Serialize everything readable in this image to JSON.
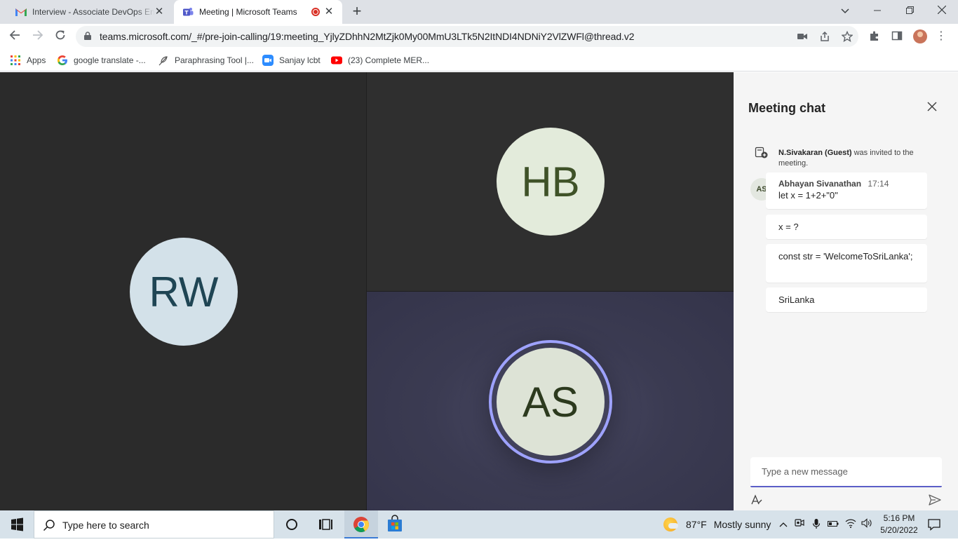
{
  "browser": {
    "tabs": [
      {
        "title": "Interview - Associate DevOps Eng",
        "icon": "gmail-icon"
      },
      {
        "title": "Meeting | Microsoft Teams",
        "icon": "teams-icon",
        "recording": true
      }
    ],
    "url": "teams.microsoft.com/_#/pre-join-calling/19:meeting_YjlyZDhhN2MtZjk0My00MmU3LTk5N2ItNDI4NDNiY2VlZWFl@thread.v2",
    "bookmarks": [
      {
        "label": "Apps",
        "icon": "apps-grid-icon"
      },
      {
        "label": "google translate -...",
        "icon": "google-icon"
      },
      {
        "label": "Paraphrasing Tool |...",
        "icon": "feather-icon"
      },
      {
        "label": "Sanjay lcbt",
        "icon": "zoom-icon"
      },
      {
        "label": "(23) Complete MER...",
        "icon": "youtube-icon"
      }
    ]
  },
  "meeting": {
    "participants": [
      {
        "initials": "RW"
      },
      {
        "initials": "HB"
      },
      {
        "initials": "AS",
        "speaking": true
      }
    ]
  },
  "chat": {
    "title": "Meeting chat",
    "system_message": {
      "name": "N.Sivakaran (Guest)",
      "text": "was invited to the meeting."
    },
    "sender": {
      "initials": "AS",
      "name": "Abhayan Sivanathan",
      "time": "17:14"
    },
    "messages": [
      "let x = 1+2+\"0\"",
      "x = ?",
      "const str = 'WelcomeToSriLanka';",
      "SriLanka"
    ],
    "compose_placeholder": "Type a new message"
  },
  "taskbar": {
    "search_placeholder": "Type here to search",
    "weather": {
      "temp": "87°F",
      "condition": "Mostly sunny"
    },
    "time": "5:16 PM",
    "date": "5/20/2022"
  },
  "colors": {
    "teams_accent": "#5b5fc7",
    "speaking_ring": "#9ea2ff",
    "stage_bg": "#2b2b2b",
    "chat_bg": "#f5f5f5",
    "taskbar_bg": "#d7e2ea"
  }
}
